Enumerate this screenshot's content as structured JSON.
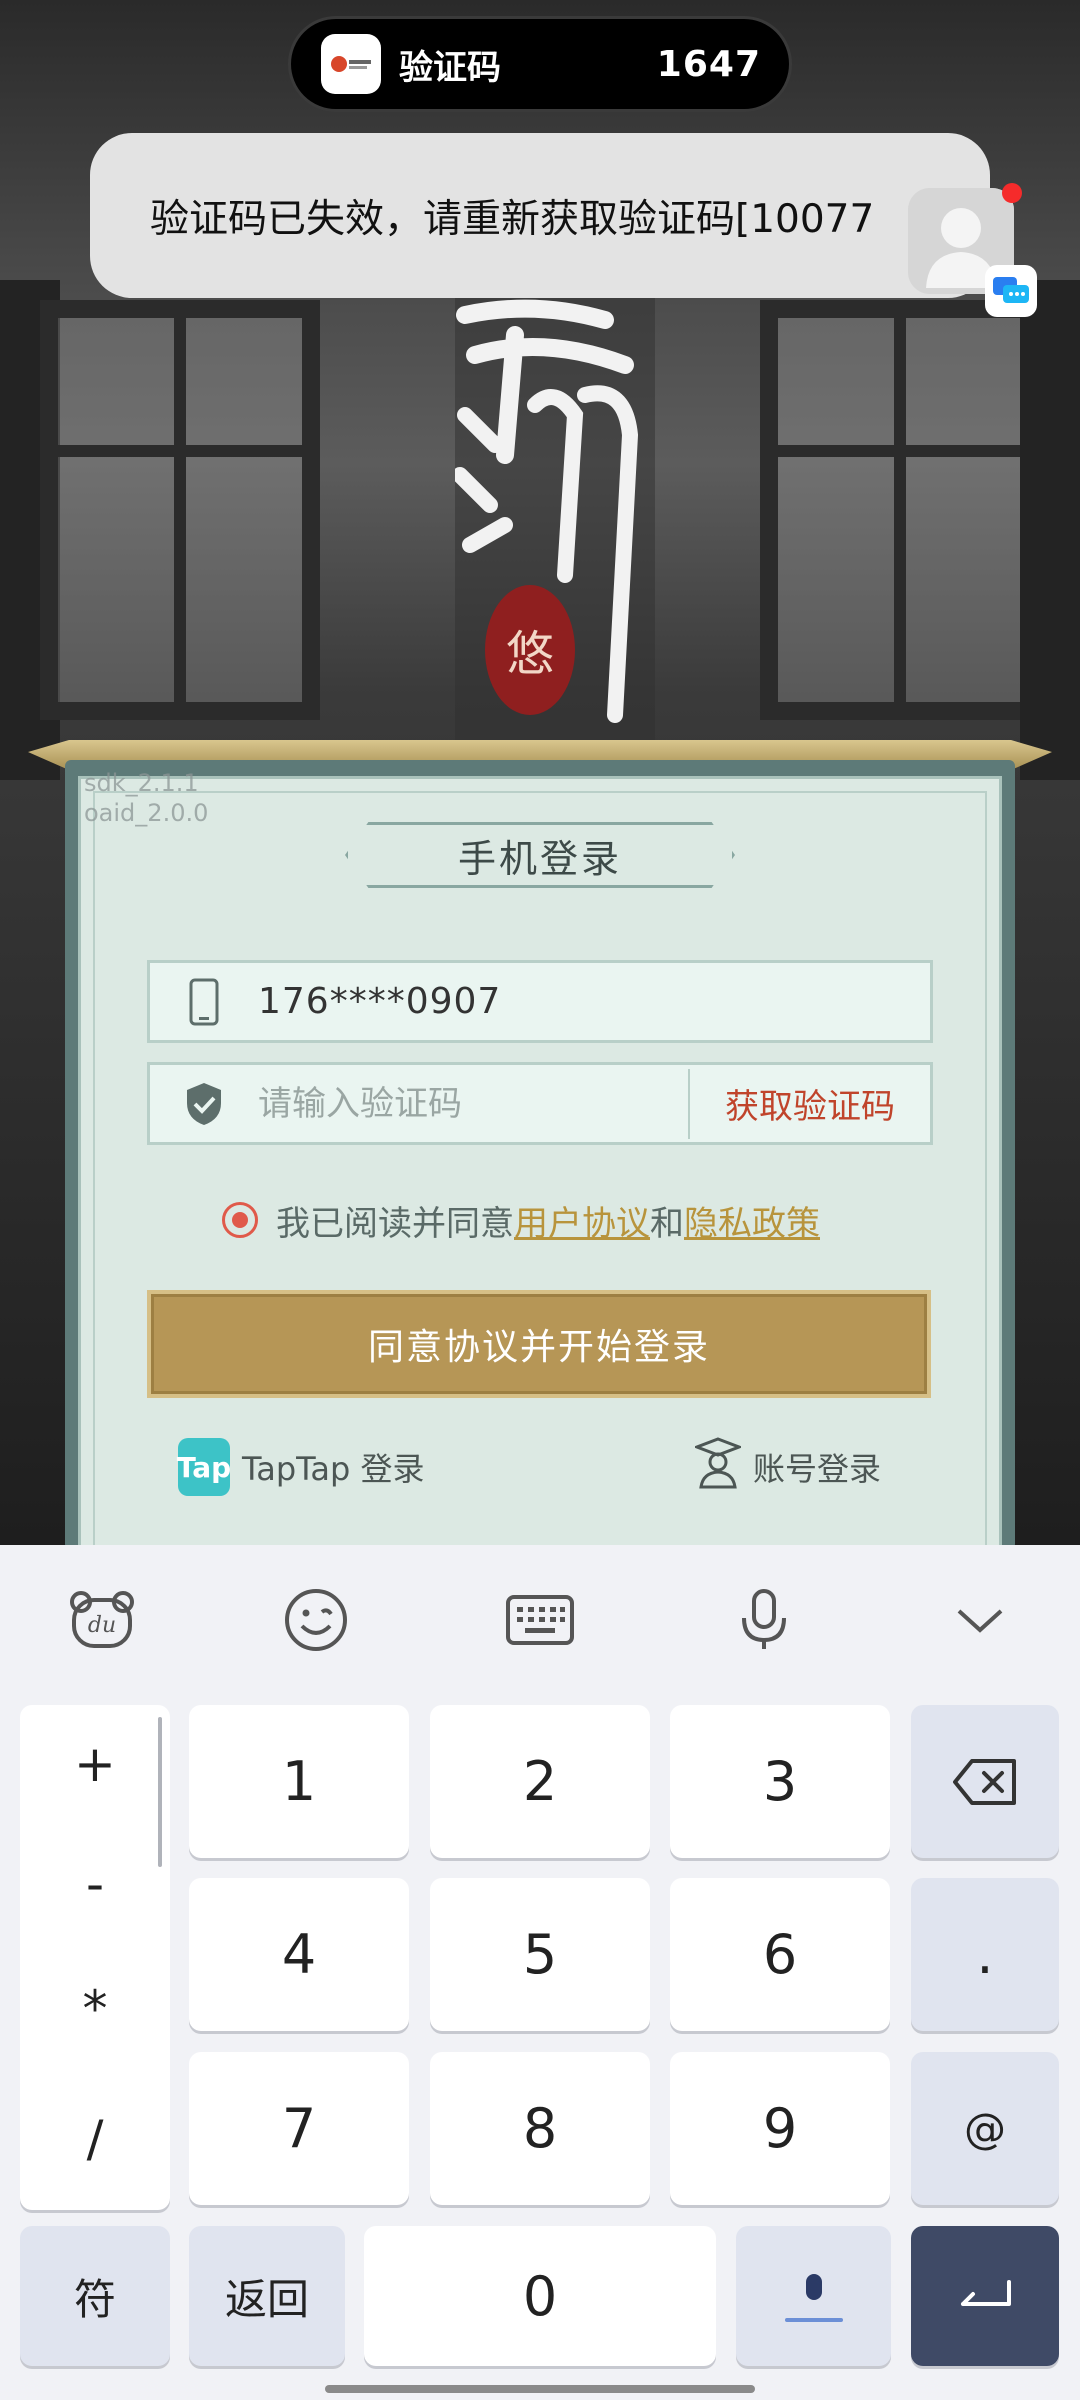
{
  "notification": {
    "app_name": "验证码",
    "code": "1647",
    "message": "验证码已失效，请重新获取验证码[10077"
  },
  "panel": {
    "sdk_line1": "sdk_2.1.1",
    "sdk_line2": "oaid_2.0.0",
    "title": "手机登录",
    "phone_value": "176****0907",
    "code_placeholder": "请输入验证码",
    "get_code_label": "获取验证码",
    "agree_prefix": "我已阅读并同意",
    "user_agreement": "用户协议",
    "and_text": "和",
    "privacy_policy": "隐私政策",
    "login_button": "同意协议并开始登录",
    "taptap_logo": "Tap",
    "taptap_login": "TapTap 登录",
    "account_login": "账号登录"
  },
  "keyboard": {
    "symbols": [
      "+",
      "-",
      "*",
      "/"
    ],
    "rows": [
      [
        "1",
        "2",
        "3"
      ],
      [
        "4",
        "5",
        "6"
      ],
      [
        "7",
        "8",
        "9"
      ]
    ],
    "right_col": [
      "⌫",
      ".",
      "@"
    ],
    "bottom": {
      "fu": "符",
      "back": "返回",
      "zero": "0"
    },
    "toolbar_icons": [
      "baidu-du-icon",
      "emoji-icon",
      "keyboard-icon",
      "mic-icon",
      "collapse-icon"
    ]
  },
  "colors": {
    "accent_gold": "#b69656",
    "get_code_red": "#c0442b",
    "link_gold": "#b8943c",
    "enter_key": "#3f4a66"
  }
}
